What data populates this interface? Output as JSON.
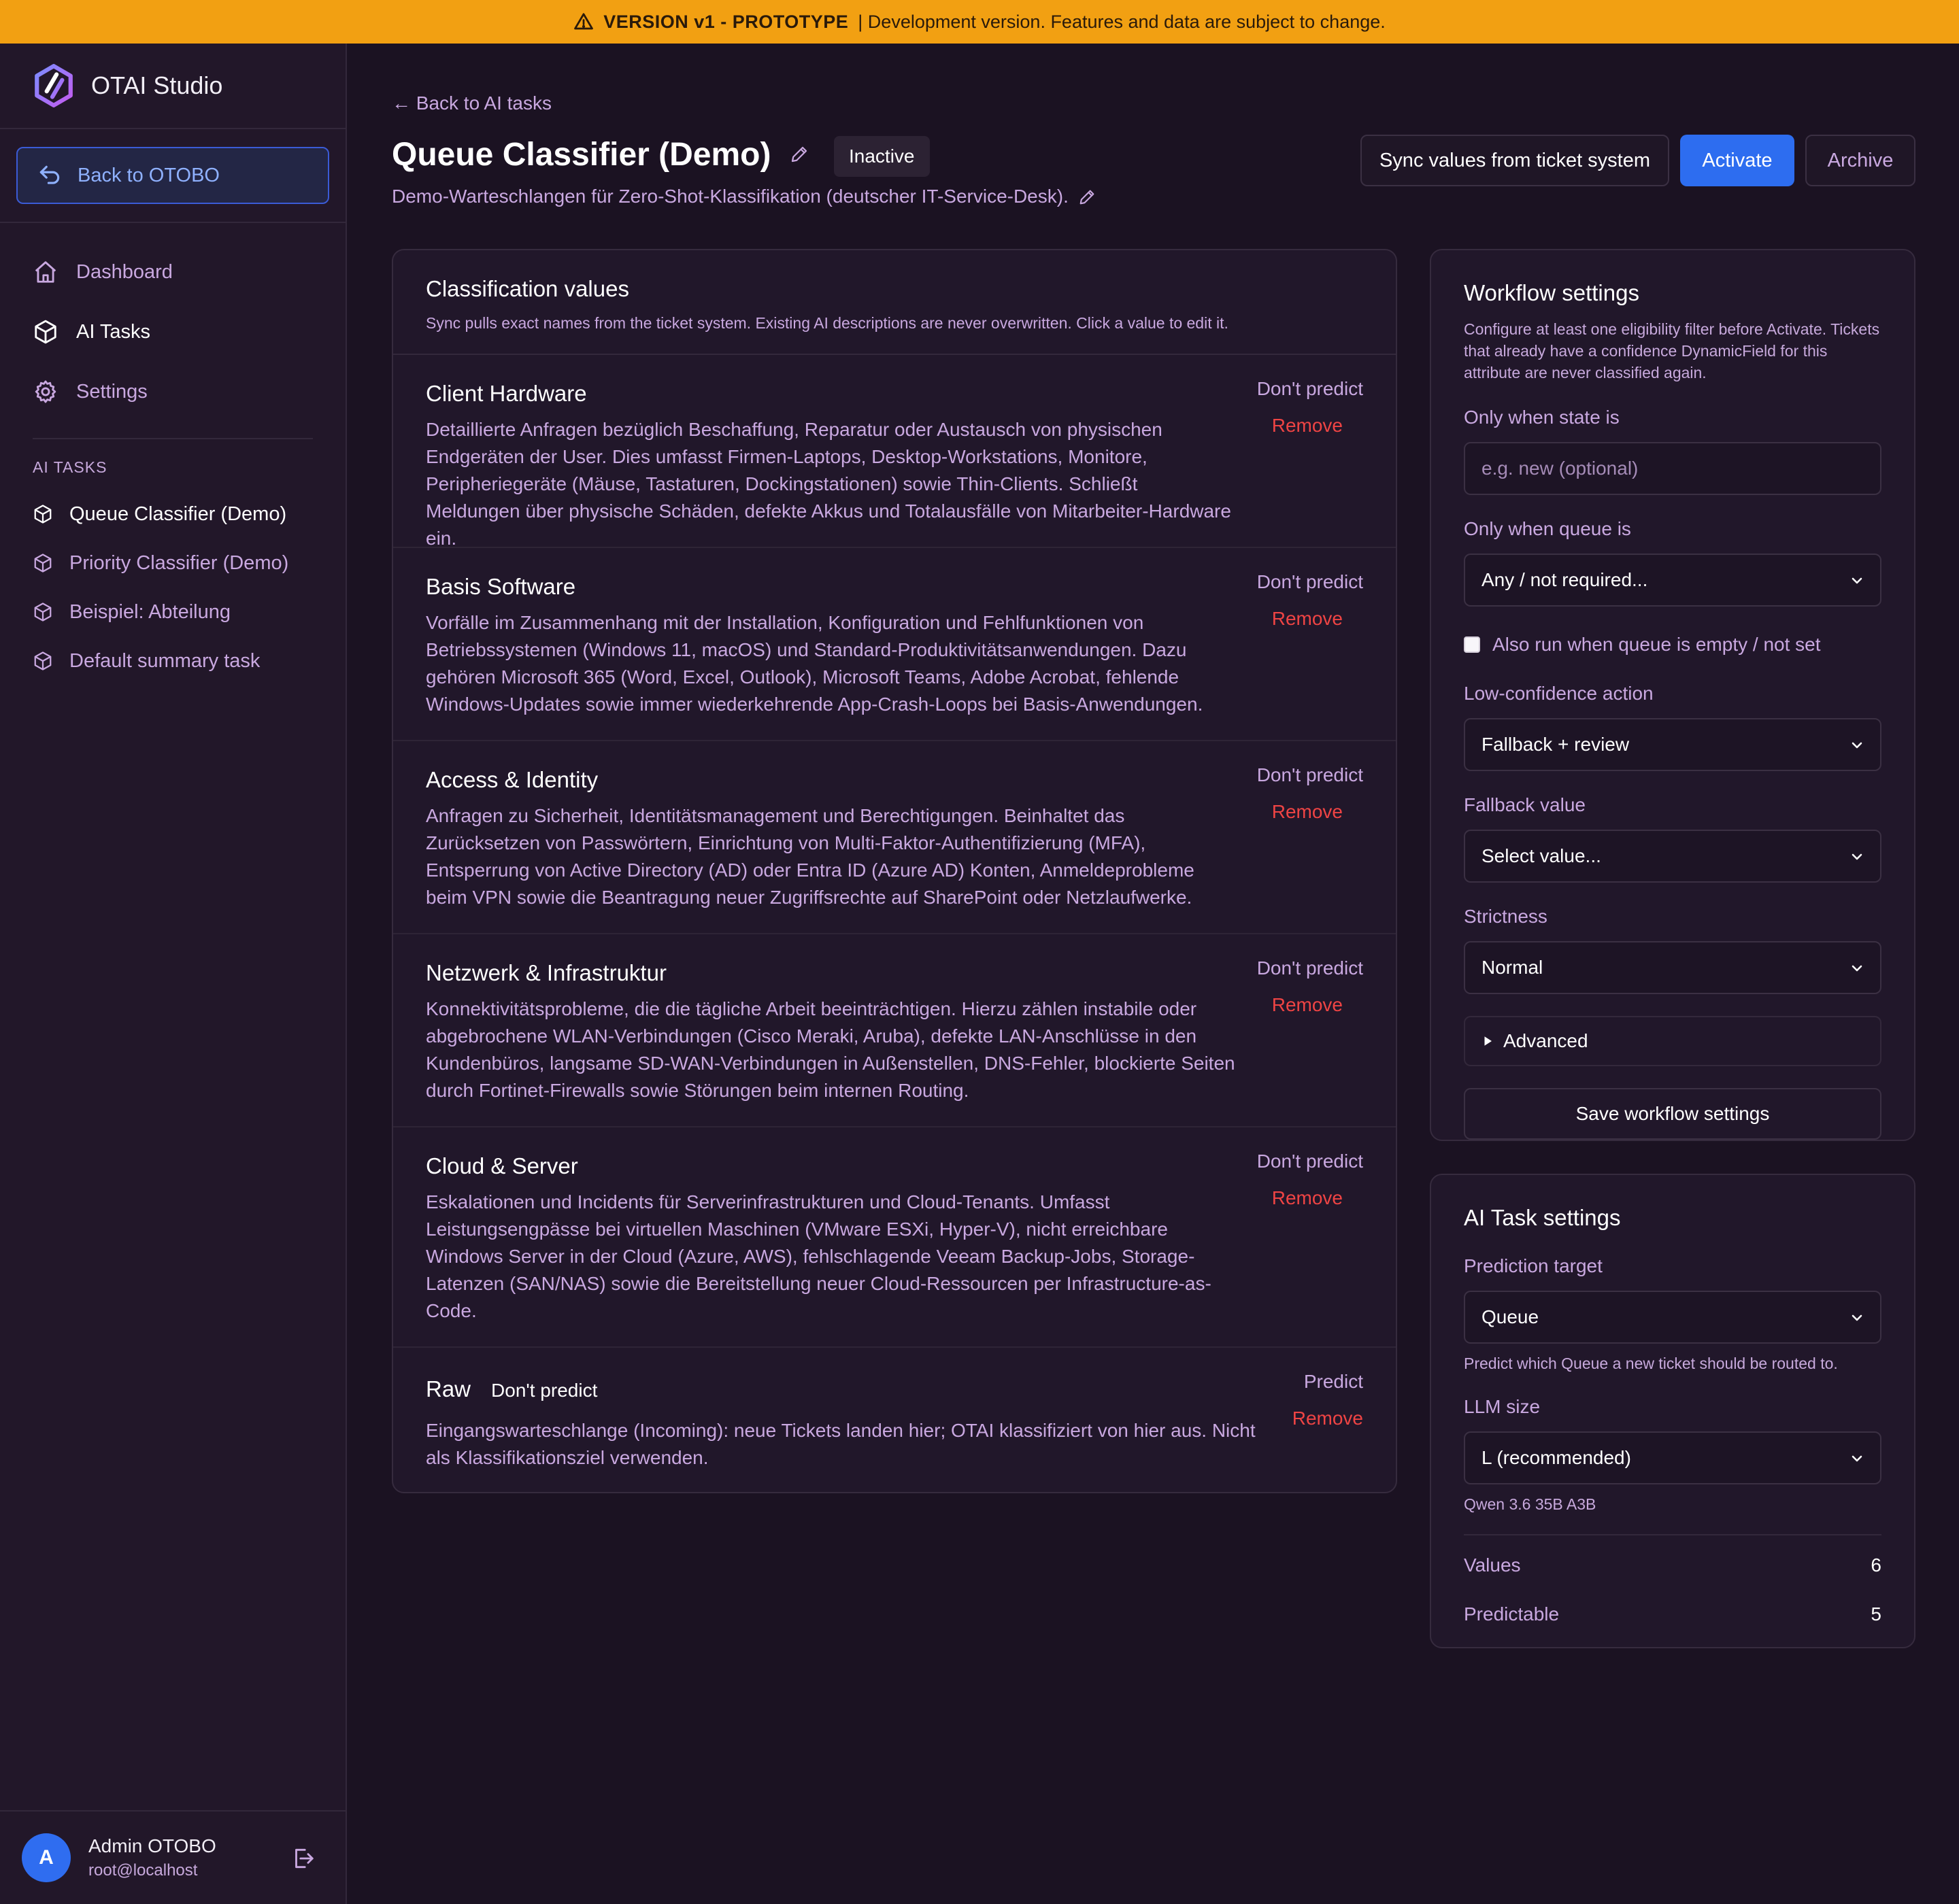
{
  "banner": {
    "icon": "warning-triangle-icon",
    "strong": "VERSION v1 - PROTOTYPE",
    "text": "| Development version. Features and data are subject to change."
  },
  "sidebar": {
    "brand": "OTAI Studio",
    "back_button": "Back to OTOBO",
    "nav": [
      {
        "label": "Dashboard",
        "icon": "home-icon"
      },
      {
        "label": "AI Tasks",
        "icon": "cube-icon"
      },
      {
        "label": "Settings",
        "icon": "gear-icon"
      }
    ],
    "section_label": "AI TASKS",
    "tasks": [
      {
        "label": "Queue Classifier (Demo)",
        "active": true
      },
      {
        "label": "Priority Classifier (Demo)",
        "active": false
      },
      {
        "label": "Beispiel: Abteilung",
        "active": false
      },
      {
        "label": "Default summary task",
        "active": false
      }
    ],
    "user": {
      "initial": "A",
      "name": "Admin OTOBO",
      "email": "root@localhost"
    }
  },
  "header": {
    "back_link": "← Back to AI tasks",
    "title": "Queue Classifier (Demo)",
    "status": "Inactive",
    "subtitle": "Demo-Warteschlangen für Zero-Shot-Klassifikation (deutscher IT-Service-Desk).",
    "buttons": {
      "sync": "Sync values from ticket system",
      "activate": "Activate",
      "archive": "Archive"
    }
  },
  "classification": {
    "title": "Classification values",
    "description": "Sync pulls exact names from the ticket system. Existing AI descriptions are never overwritten. Click a value to edit it.",
    "values": [
      {
        "name": "Client Hardware",
        "predict_label": "Don't predict",
        "remove_label": "Remove",
        "description": "Detaillierte Anfragen bezüglich Beschaffung, Reparatur oder Austausch von physischen Endgeräten der User. Dies umfasst Firmen-Laptops, Desktop-Workstations, Monitore, Peripheriegeräte (Mäuse, Tastaturen, Dockingstationen) sowie Thin-Clients. Schließt Meldungen über physische Schäden, defekte Akkus und Totalausfälle von Mitarbeiter-Hardware ein."
      },
      {
        "name": "Basis Software",
        "predict_label": "Don't predict",
        "remove_label": "Remove",
        "description": "Vorfälle im Zusammenhang mit der Installation, Konfiguration und Fehlfunktionen von Betriebssystemen (Windows 11, macOS) und Standard-Produktivitätsanwendungen. Dazu gehören Microsoft 365 (Word, Excel, Outlook), Microsoft Teams, Adobe Acrobat, fehlende Windows-Updates sowie immer wiederkehrende App-Crash-Loops bei Basis-Anwendungen."
      },
      {
        "name": "Access & Identity",
        "predict_label": "Don't predict",
        "remove_label": "Remove",
        "description": "Anfragen zu Sicherheit, Identitätsmanagement und Berechtigungen. Beinhaltet das Zurücksetzen von Passwörtern, Einrichtung von Multi-Faktor-Authentifizierung (MFA), Entsperrung von Active Directory (AD) oder Entra ID (Azure AD) Konten, Anmeldeprobleme beim VPN sowie die Beantragung neuer Zugriffsrechte auf SharePoint oder Netzlaufwerke."
      },
      {
        "name": "Netzwerk & Infrastruktur",
        "predict_label": "Don't predict",
        "remove_label": "Remove",
        "description": "Konnektivitätsprobleme, die die tägliche Arbeit beeinträchtigen. Hierzu zählen instabile oder abgebrochene WLAN-Verbindungen (Cisco Meraki, Aruba), defekte LAN-Anschlüsse in den Kundenbüros, langsame SD-WAN-Verbindungen in Außenstellen, DNS-Fehler, blockierte Seiten durch Fortinet-Firewalls sowie Störungen beim internen Routing."
      },
      {
        "name": "Cloud & Server",
        "predict_label": "Don't predict",
        "remove_label": "Remove",
        "description": "Eskalationen und Incidents für Serverinfrastrukturen und Cloud-Tenants. Umfasst Leistungsengpässe bei virtuellen Maschinen (VMware ESXi, Hyper-V), nicht erreichbare Windows Server in der Cloud (Azure, AWS), fehlschlagende Veeam Backup-Jobs, Storage-Latenzen (SAN/NAS) sowie die Bereitstellung neuer Cloud-Ressourcen per Infrastructure-as-Code."
      }
    ],
    "raw": {
      "name": "Raw",
      "tag": "Don't predict",
      "predict_label": "Predict",
      "remove_label": "Remove",
      "description": "Eingangswarteschlange (Incoming): neue Tickets landen hier; OTAI klassifiziert von hier aus. Nicht als Klassifikationsziel verwenden."
    }
  },
  "workflow": {
    "title": "Workflow settings",
    "description": "Configure at least one eligibility filter before Activate. Tickets that already have a confidence DynamicField for this attribute are never classified again.",
    "state_label": "Only when state is",
    "state_placeholder": "e.g. new (optional)",
    "queue_label": "Only when queue is",
    "queue_value": "Any / not required...",
    "empty_queue_label": "Also run when queue is empty / not set",
    "lowconf_label": "Low-confidence action",
    "lowconf_value": "Fallback + review",
    "fallback_label": "Fallback value",
    "fallback_value": "Select value...",
    "strictness_label": "Strictness",
    "strictness_value": "Normal",
    "advanced_label": "Advanced",
    "save_label": "Save workflow settings"
  },
  "ai_task": {
    "title": "AI Task settings",
    "target_label": "Prediction target",
    "target_value": "Queue",
    "target_hint": "Predict which Queue a new ticket should be routed to.",
    "llm_label": "LLM size",
    "llm_value": "L (recommended)",
    "llm_hint": "Qwen 3.6 35B A3B",
    "values_label": "Values",
    "values_count": "6",
    "predictable_label": "Predictable",
    "predictable_count": "5"
  },
  "colors": {
    "accent": "#2d6df0",
    "banner": "#f2a012",
    "remove": "#ef4444",
    "muted": "#c9a8e0"
  }
}
